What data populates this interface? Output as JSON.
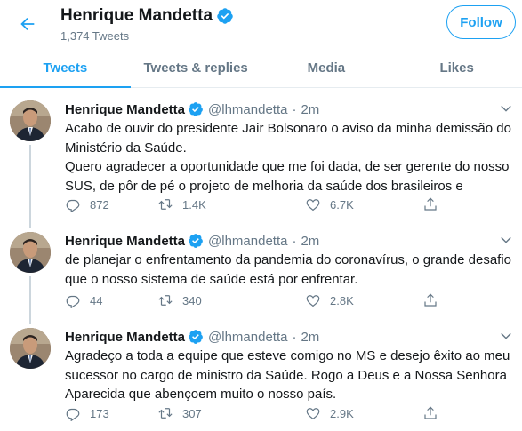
{
  "header": {
    "name": "Henrique Mandetta",
    "tweet_count": "1,374 Tweets",
    "follow_label": "Follow"
  },
  "tabs": [
    {
      "label": "Tweets",
      "active": true
    },
    {
      "label": "Tweets & replies",
      "active": false
    },
    {
      "label": "Media",
      "active": false
    },
    {
      "label": "Likes",
      "active": false
    }
  ],
  "tweets": [
    {
      "name": "Henrique Mandetta",
      "handle": "@lhmandetta",
      "time": "2m",
      "text": "Acabo de ouvir do presidente Jair Bolsonaro o aviso da minha demissão do Ministério da Saúde.\nQuero agradecer a oportunidade que me foi dada, de ser gerente do nosso SUS, de pôr de pé o projeto de melhoria da saúde dos brasileiros e",
      "replies": "872",
      "retweets": "1.4K",
      "likes": "6.7K"
    },
    {
      "name": "Henrique Mandetta",
      "handle": "@lhmandetta",
      "time": "2m",
      "text": "de planejar o enfrentamento da pandemia do coronavírus, o grande desafio que o nosso sistema de saúde está por enfrentar.",
      "replies": "44",
      "retweets": "340",
      "likes": "2.8K"
    },
    {
      "name": "Henrique Mandetta",
      "handle": "@lhmandetta",
      "time": "2m",
      "text": "Agradeço a toda a equipe que esteve comigo no MS e desejo êxito ao meu sucessor no cargo de ministro da Saúde. Rogo a Deus e a Nossa Senhora Aparecida que abençoem muito o nosso país.",
      "replies": "173",
      "retweets": "307",
      "likes": "2.9K"
    }
  ],
  "colors": {
    "accent": "#1da1f2",
    "text": "#14171a",
    "muted": "#657786",
    "border": "#e6ecf0"
  },
  "icons": [
    "back-arrow-icon",
    "verified-badge-icon",
    "chevron-down-icon",
    "reply-icon",
    "retweet-icon",
    "like-icon",
    "share-icon"
  ]
}
